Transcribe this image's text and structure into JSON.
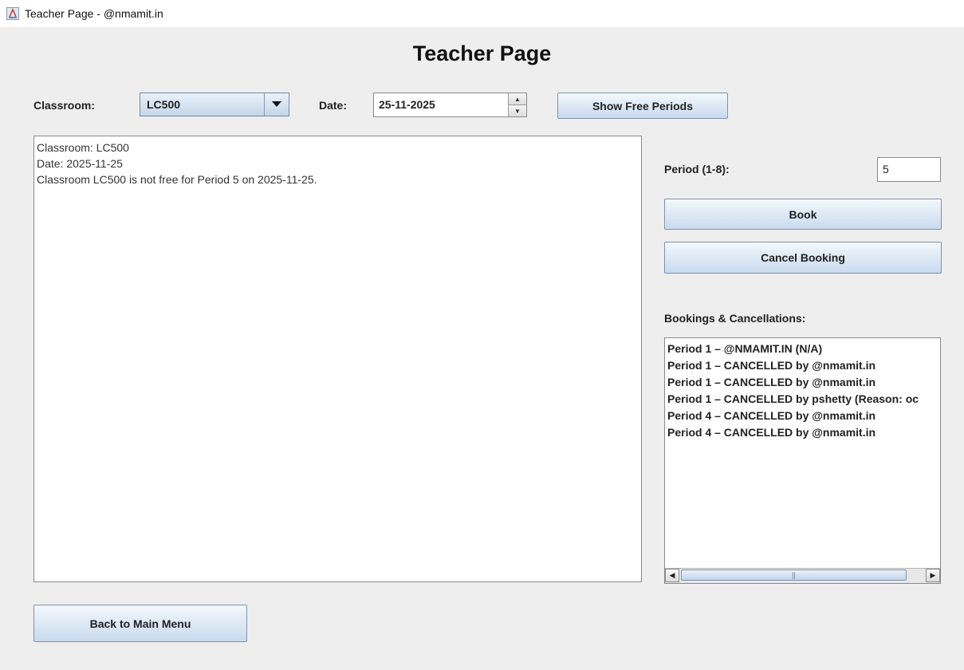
{
  "window": {
    "title": "Teacher Page - @nmamit.in"
  },
  "heading": "Teacher Page",
  "classroom": {
    "label": "Classroom:",
    "selected": "LC500"
  },
  "date": {
    "label": "Date:",
    "value": "25-11-2025"
  },
  "show_free_periods_label": "Show Free Periods",
  "output": {
    "lines": [
      "Classroom: LC500",
      "Date: 2025-11-25",
      "",
      "Classroom LC500 is not free for Period 5 on 2025-11-25."
    ]
  },
  "period": {
    "label": "Period (1-8):",
    "value": "5"
  },
  "book_label": "Book",
  "cancel_booking_label": "Cancel Booking",
  "bookings": {
    "label": "Bookings & Cancellations:",
    "items": [
      "Period 1 – @NMAMIT.IN (N/A)",
      "Period 1 – CANCELLED by @nmamit.in",
      "Period 1 – CANCELLED by @nmamit.in",
      "Period 1 – CANCELLED by pshetty (Reason: oc",
      "Period 4 – CANCELLED by @nmamit.in",
      "Period 4 – CANCELLED by @nmamit.in"
    ],
    "scroll_thumb_grip": "||"
  },
  "back_label": "Back to Main Menu",
  "colors": {
    "window_bg": "#eeeeee",
    "button_top": "#f3f8fd",
    "button_bottom": "#c9daee",
    "border": "#7f93ad"
  }
}
